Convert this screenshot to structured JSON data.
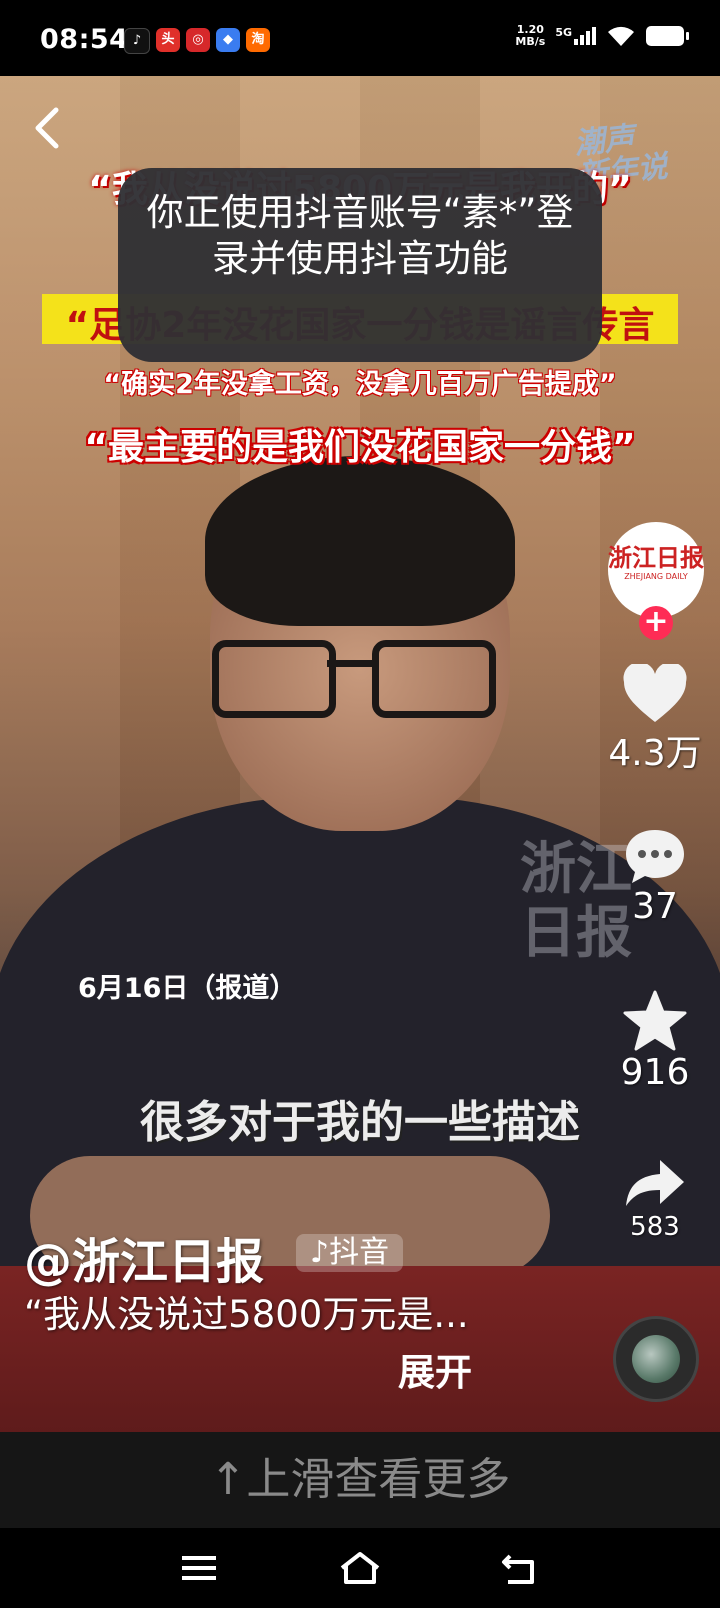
{
  "status_bar": {
    "time": "08:54",
    "net_speed_value": "1.20",
    "net_speed_unit": "MB/s",
    "network": "5G",
    "apps": [
      {
        "label": "♪",
        "color": "#111111"
      },
      {
        "label": "头",
        "color": "#e0302a"
      },
      {
        "label": "◎",
        "color": "#d6282a"
      },
      {
        "label": "◆",
        "color": "#3a7cf0"
      },
      {
        "label": "淘",
        "color": "#ff6a00"
      }
    ]
  },
  "video": {
    "caption_line1": "“我从没说过5800万元是我开的”",
    "caption_line2": "“足协2年没花国家一分钱是谣言传言",
    "caption_line3": "“确实2年没拿工资，没拿几百万广告提成”",
    "caption_line4": "“最主要的是我们没花国家一分钱”",
    "watermark_top": "潮声\n新年说",
    "watermark_side": "浙江\n日报",
    "date_tag": "6月16日（报道）",
    "subtitle": "很多对于我的一些描述"
  },
  "toast": {
    "text": "你正使用抖音账号“素*”登录并使用抖音功能"
  },
  "side_rail": {
    "avatar_text": "浙江日报",
    "avatar_subtext": "ZHEJIANG DAILY",
    "follow_symbol": "+",
    "likes": "4.3万",
    "comments": "37",
    "favorites": "916",
    "shares": "583"
  },
  "post": {
    "author": "@浙江日报",
    "platform_badge": "抖音",
    "description": "“我从没说过5800万元是...",
    "expand_label": "展开"
  },
  "bottom": {
    "more_hint": "↑上滑查看更多"
  }
}
